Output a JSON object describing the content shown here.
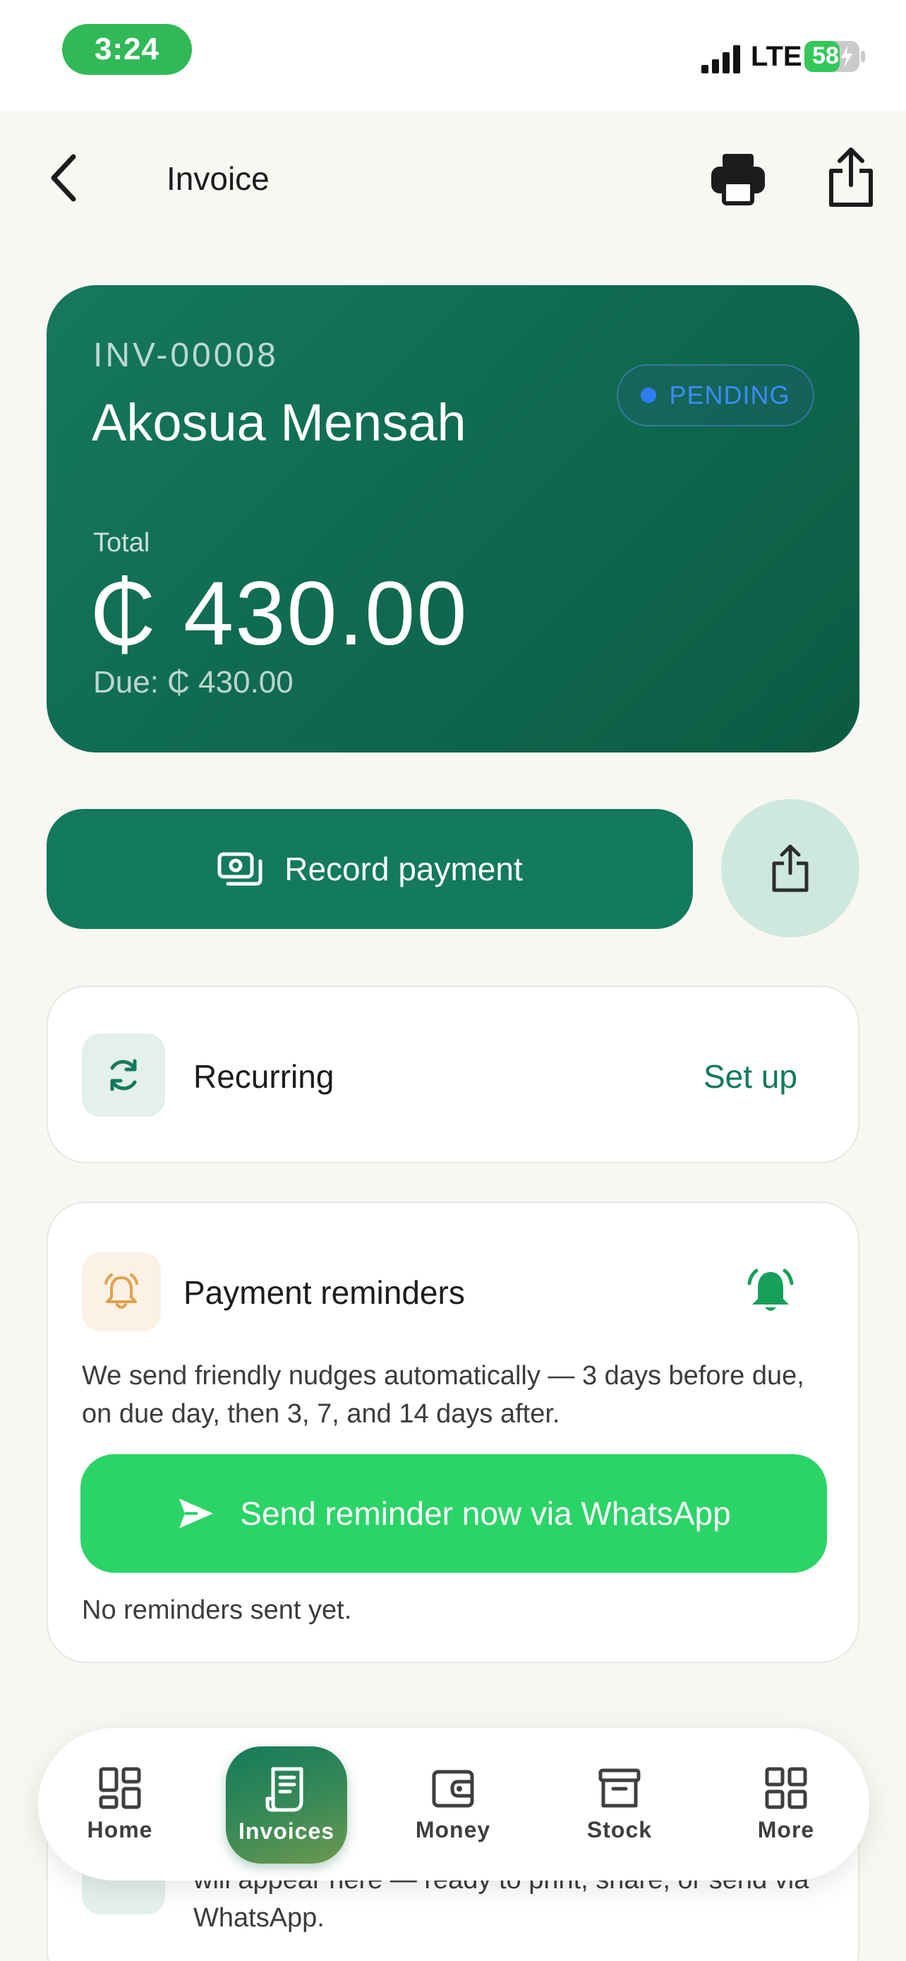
{
  "status_bar": {
    "time": "3:24",
    "network": "LTE",
    "battery": "58"
  },
  "header": {
    "title": "Invoice"
  },
  "invoice": {
    "number": "INV-00008",
    "client": "Akosua Mensah",
    "status": "PENDING",
    "total_label": "Total",
    "total": "₵ 430.00",
    "due": "Due: ₵ 430.00"
  },
  "actions": {
    "record_payment": "Record payment"
  },
  "recurring": {
    "label": "Recurring",
    "action": "Set up"
  },
  "reminders": {
    "title": "Payment reminders",
    "description": "We send friendly nudges automatically — 3 days before due, on due day, then 3, 7, and 14 days after.",
    "send_button": "Send reminder now via WhatsApp",
    "empty_text": "No reminders sent yet."
  },
  "bottom_card": {
    "text": "will appear here — ready to print, share, or send via WhatsApp."
  },
  "tab_bar": {
    "home": "Home",
    "invoices": "Invoices",
    "money": "Money",
    "stock": "Stock",
    "more": "More"
  },
  "colors": {
    "brand_green": "#137a5c",
    "whatsapp_green": "#2bd467",
    "pending_blue": "#3b8cf5",
    "status_pill_green": "#31b957"
  }
}
